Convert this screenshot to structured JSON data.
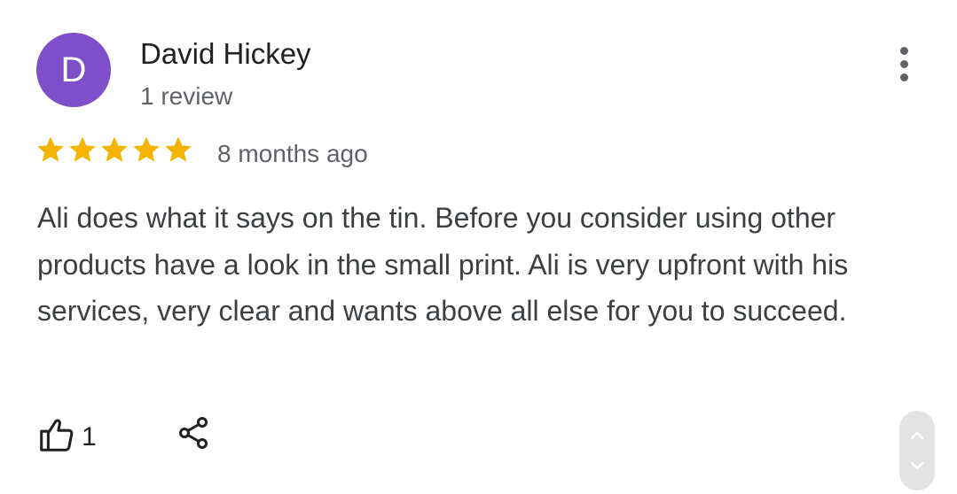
{
  "reviewer": {
    "initial": "D",
    "name": "David Hickey",
    "review_count": "1 review",
    "avatar_color": "#7e4fc9"
  },
  "rating": {
    "stars": 5,
    "max_stars": 5,
    "star_color": "#f4b400",
    "time_ago": "8 months ago"
  },
  "review": {
    "text": "Ali does what it says on the tin. Before you consider using other products have a look in the small print. Ali is very upfront with his services, very clear and wants above all else for you to succeed."
  },
  "actions": {
    "like_count": "1",
    "like_icon": "thumbs-up-icon",
    "share_icon": "share-icon",
    "more_icon": "more-vert-icon"
  },
  "scroll_control": {
    "up_icon": "chevron-up-icon",
    "down_icon": "chevron-down-icon"
  }
}
